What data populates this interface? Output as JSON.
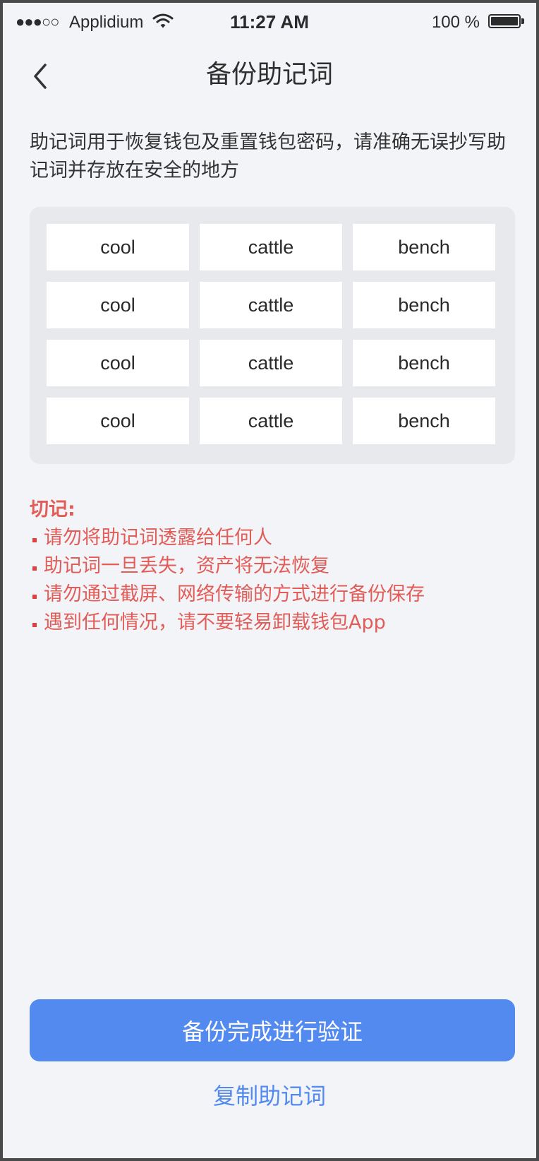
{
  "status_bar": {
    "signal": "●●●○○",
    "carrier": "Applidium",
    "time": "11:27 AM",
    "battery_percent": "100 %",
    "battery_level": 1.0,
    "icons": [
      "wifi-icon",
      "battery-icon"
    ]
  },
  "nav": {
    "back_icon": "chevron-left-icon",
    "title": "备份助记词"
  },
  "intro": "助记词用于恢复钱包及重置钱包密码，请准确无误抄写助记词并存放在安全的地方",
  "words": [
    "cool",
    "cattle",
    "bench",
    "cool",
    "cattle",
    "bench",
    "cool",
    "cattle",
    "bench",
    "cool",
    "cattle",
    "bench"
  ],
  "warning": {
    "title": "切记:",
    "items": [
      "请勿将助记词透露给任何人",
      "助记词一旦丢失，资产将无法恢复",
      "请勿通过截屏、网络传输的方式进行备份保存",
      "遇到任何情况，请不要轻易卸载钱包App"
    ]
  },
  "actions": {
    "primary_label": "备份完成进行验证",
    "copy_label": "复制助记词"
  },
  "colors": {
    "accent": "#528af0",
    "warning": "#e25c58",
    "background": "#f2f4f8"
  }
}
